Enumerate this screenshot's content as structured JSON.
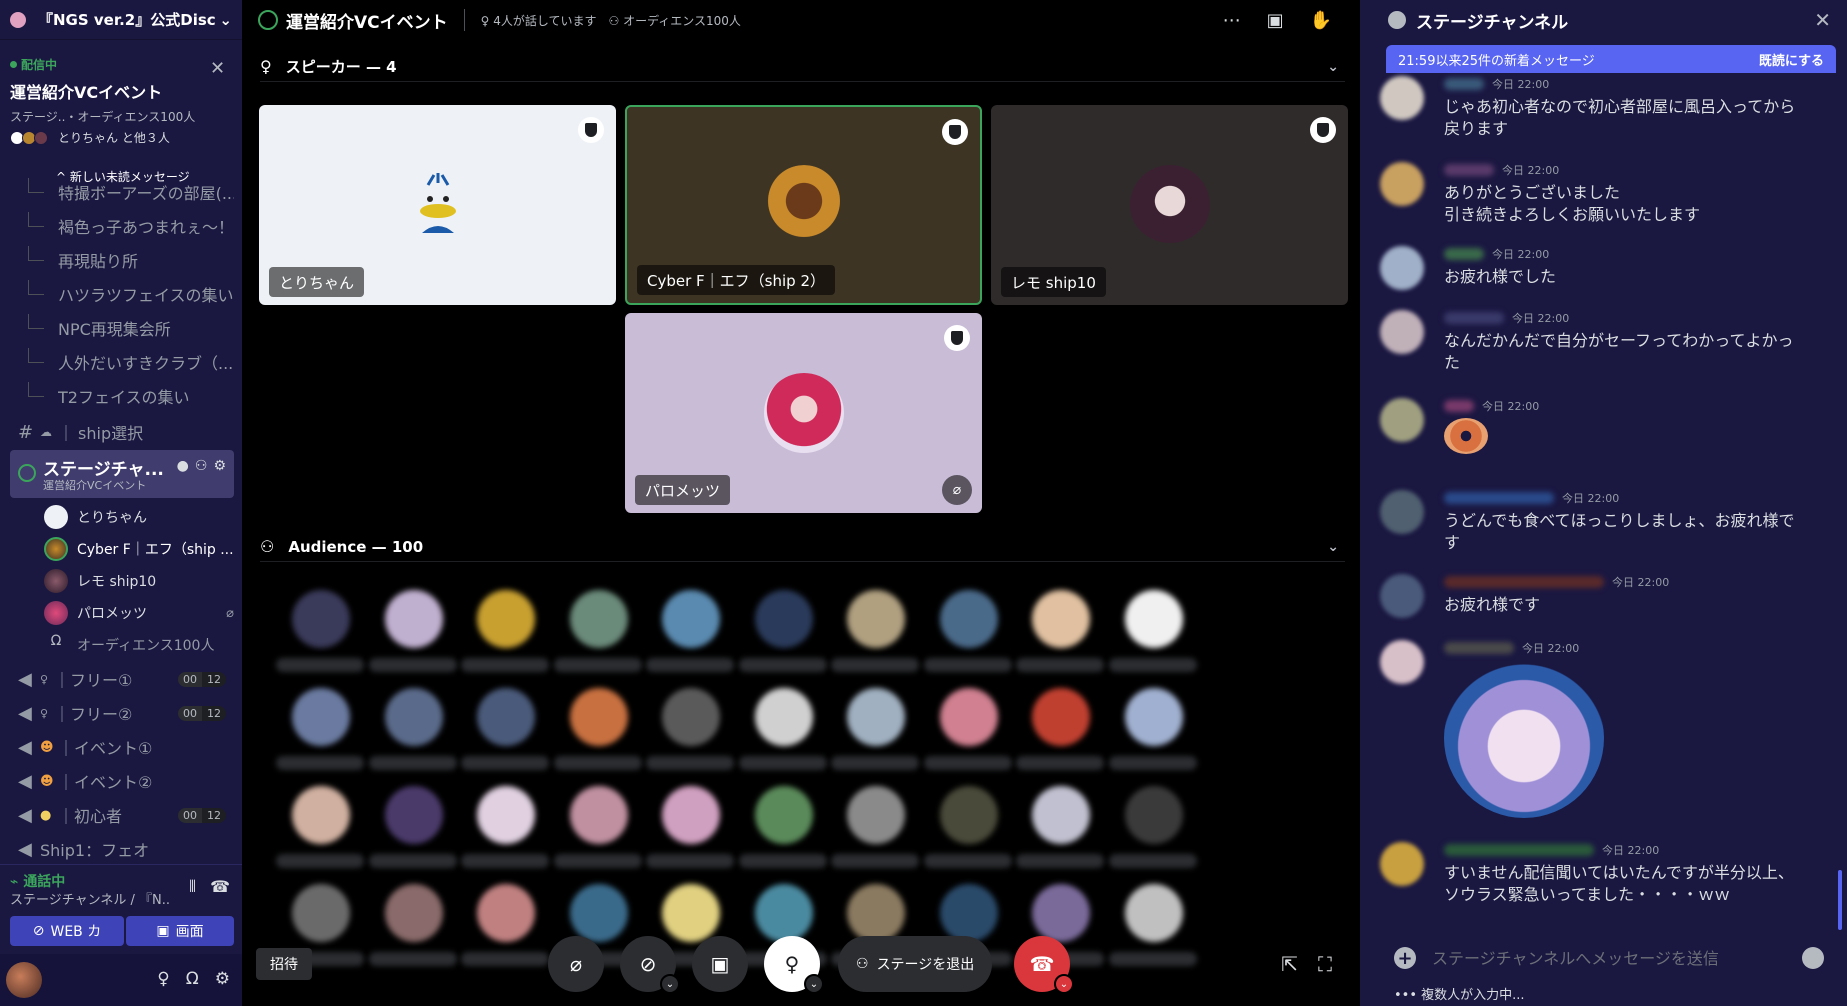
{
  "server": {
    "name": "『NGS ver.2』公式Disc"
  },
  "live": {
    "tag": "配信中",
    "title": "運営紹介VCイベント",
    "sub": "ステージ..・オーディエンス100人",
    "users": "とりちゃん と他３人"
  },
  "sidebar": {
    "unread": "新しい未読メッセージ",
    "tree": [
      "特撮ボーアーズの部屋(...",
      "褐色っ子あつまれぇ～！",
      "再現貼り所",
      "ハツラツフェイスの集い",
      "NPC再現集会所",
      "人外だいすきクラブ（...",
      "T2フェイスの集い"
    ],
    "ship_channel": "ship選択",
    "stage_channel": {
      "name": "ステージチャ...",
      "sub": "運営紹介VCイベント"
    },
    "vc_users": [
      "とりちゃん",
      "Cyber F｜エフ（ship ...",
      "レモ ship10",
      "パロメッツ",
      "オーディエンス100人"
    ],
    "channels": [
      {
        "name": "｜フリー①",
        "a": "00",
        "b": "12"
      },
      {
        "name": "｜フリー②",
        "a": "00",
        "b": "12"
      },
      {
        "name": "｜イベント①"
      },
      {
        "name": "｜イベント②"
      },
      {
        "name": "｜初心者",
        "a": "00",
        "b": "12"
      },
      {
        "name": "Ship1：フェオ"
      }
    ]
  },
  "voice": {
    "status": "通話中",
    "sub": "ステージチャンネル / 『N...",
    "web_button": "WEB カ",
    "screen_button": "画面"
  },
  "stage": {
    "title": "運営紹介VCイベント",
    "speaking": "4人が話しています",
    "audience_count": "オーディエンス100人",
    "speakers_header": "スピーカー — 4",
    "audience_header": "Audience — 100",
    "speakers": [
      {
        "name": "とりちゃん",
        "bg": "#eef2f6"
      },
      {
        "name": "Cyber F｜エフ（ship 2）",
        "bg": "#3d3424"
      },
      {
        "name": "レモ ship10",
        "bg": "#2f2b2b"
      },
      {
        "name": "パロメッツ",
        "bg": "#c9bcd6"
      }
    ],
    "invite": "招待",
    "leave": "ステージを退出"
  },
  "chat": {
    "title": "ステージチャンネル",
    "banner": "21:59以来25件の新着メッセージ",
    "mark_read": "既読にする",
    "messages": [
      {
        "time": "今日 22:00",
        "text": "じゃあ初心者なので初心者部屋に風呂入ってから戻ります"
      },
      {
        "time": "今日 22:00",
        "text": "ありがとうございました\n引き続きよろしくお願いいたします"
      },
      {
        "time": "今日 22:00",
        "text": "お疲れ様でした"
      },
      {
        "time": "今日 22:00",
        "text": "なんだかんだで自分がセーフってわかってよかった"
      },
      {
        "time": "今日 22:00",
        "text": ""
      },
      {
        "time": "今日 22:00",
        "text": "うどんでも食べてほっこりしましょ、お疲れ様です"
      },
      {
        "time": "今日 22:00",
        "text": "お疲れ様です"
      },
      {
        "time": "今日 22:00",
        "text": ""
      },
      {
        "time": "今日 22:00",
        "text": "すいません配信聞いてはいたんですが半分以上、ソウラス緊急いってました・・・・ｗｗ"
      }
    ],
    "placeholder": "ステージチャンネルへメッセージを送信",
    "typing": "複数人が入力中..."
  },
  "colors": {
    "accent": "#5865f2",
    "live": "#3ba55c",
    "danger": "#da373c"
  }
}
